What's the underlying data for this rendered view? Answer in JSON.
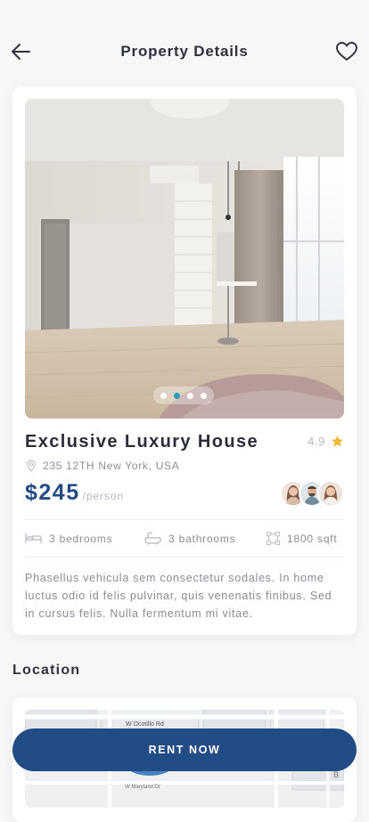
{
  "header": {
    "title": "Property Details",
    "back_icon": "arrow-left-icon",
    "favorite_icon": "heart-icon"
  },
  "property": {
    "name": "Exclusive Luxury House",
    "rating": "4.9",
    "address": "235 12TH New York, USA",
    "price": "$245",
    "price_unit": "/person",
    "gallery_total": 4,
    "gallery_active_index": 1,
    "features": [
      {
        "icon": "bed-icon",
        "label": "3 bedrooms"
      },
      {
        "icon": "bathtub-icon",
        "label": "3 bathrooms"
      },
      {
        "icon": "area-icon",
        "label": "1800 sqft"
      }
    ],
    "description": "Phasellus vehicula sem consectetur sodales. In home luctus odio id felis pulvinar, quis venenatis finibus. Sed in cursus felis. Nulla fermentum mi vitae."
  },
  "location": {
    "title": "Location",
    "map_labels": {
      "street_top": "W Ocotillo Rd",
      "street_bottom": "W Maryland Dr",
      "corner_letter": "B"
    }
  },
  "cta": {
    "label": "RENT NOW"
  },
  "colors": {
    "accent": "#214c85",
    "price": "#224b86",
    "star": "#f2b633",
    "dot_active": "#2a9db1"
  }
}
